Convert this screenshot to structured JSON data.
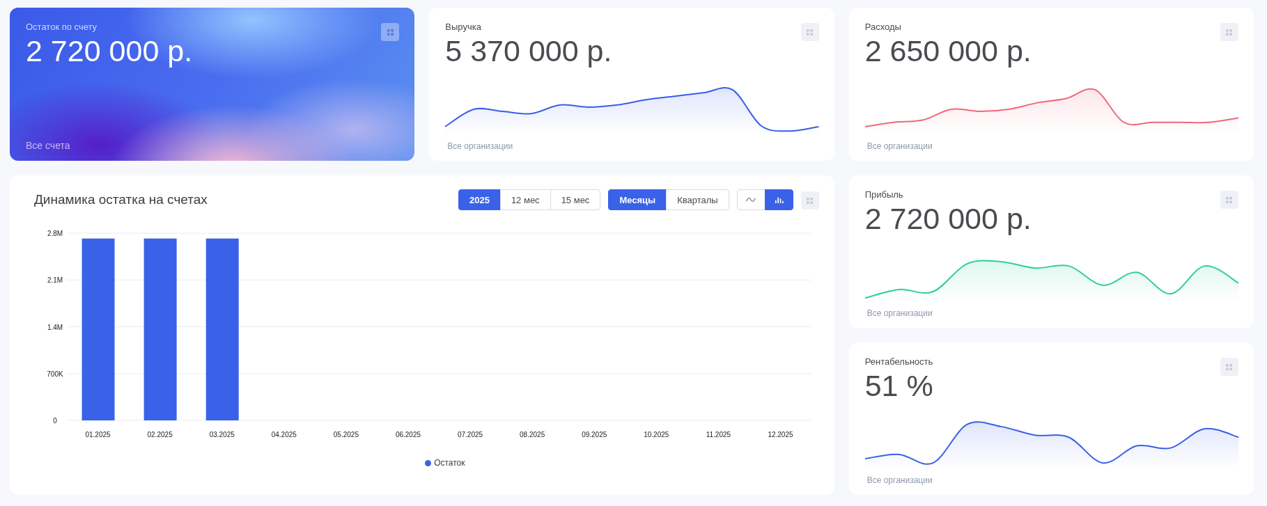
{
  "top_cards": [
    {
      "kind": "hero",
      "label": "Остаток по счету",
      "value": "2 720 000 р.",
      "footer": "Все счета"
    },
    {
      "kind": "metric",
      "label": "Выручка",
      "value": "5 370 000 р.",
      "footer": "Все организации",
      "color": "#3a5ee8"
    },
    {
      "kind": "metric",
      "label": "Расходы",
      "value": "2 650 000 р.",
      "footer": "Все организации",
      "color": "#f2677d"
    }
  ],
  "balance_panel": {
    "title": "Динамика остатка на счетах",
    "period_options": [
      {
        "label": "2025",
        "selected": true
      },
      {
        "label": "12 мес",
        "selected": false
      },
      {
        "label": "15 мес",
        "selected": false
      }
    ],
    "granularity_options": [
      {
        "label": "Месяцы",
        "selected": true
      },
      {
        "label": "Кварталы",
        "selected": false
      }
    ],
    "chart_type_options": [
      {
        "kind": "line",
        "selected": false
      },
      {
        "kind": "bar",
        "selected": true
      }
    ],
    "chart_data": {
      "type": "bar",
      "categories": [
        "01.2025",
        "02.2025",
        "03.2025",
        "04.2025",
        "05.2025",
        "06.2025",
        "07.2025",
        "08.2025",
        "09.2025",
        "10.2025",
        "11.2025",
        "12.2025"
      ],
      "series": [
        {
          "name": "Остаток",
          "color": "#3a62e8",
          "values": [
            2720000,
            2720000,
            2720000,
            null,
            null,
            null,
            null,
            null,
            null,
            null,
            null,
            null
          ]
        }
      ],
      "ylim": [
        0,
        2800000
      ],
      "grid": true,
      "yticks": [
        {
          "value": 0,
          "label": "0"
        },
        {
          "value": 700000,
          "label": "700K"
        },
        {
          "value": 1400000,
          "label": "1.4M"
        },
        {
          "value": 2100000,
          "label": "2.1M"
        },
        {
          "value": 2800000,
          "label": "2.8M"
        }
      ]
    }
  },
  "side_cards": [
    {
      "kind": "metric",
      "label": "Прибыль",
      "value": "2 720 000 р.",
      "footer": "Все организации",
      "color": "#2ecf9a"
    },
    {
      "kind": "metric",
      "label": "Рентабельность",
      "value": "51 %",
      "footer": "Все организации",
      "color": "#3a5ee8"
    }
  ]
}
